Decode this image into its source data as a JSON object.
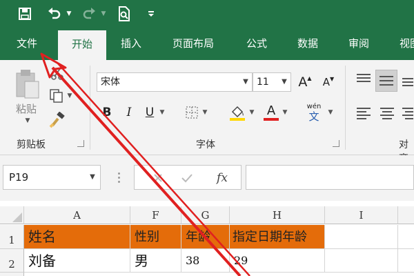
{
  "colors": {
    "brand": "#217346",
    "ribbon_bg": "#f3f3f3",
    "header_fill": "#e46c0a",
    "annotation": "#e02020"
  },
  "quick_access": {
    "icons": [
      "save-icon",
      "undo-icon",
      "redo-icon",
      "print-preview-icon",
      "customize-icon"
    ]
  },
  "tabs": [
    "文件",
    "开始",
    "插入",
    "页面布局",
    "公式",
    "数据",
    "审阅",
    "视图"
  ],
  "active_tab": "开始",
  "clipboard": {
    "paste_label": "粘贴",
    "group_label": "剪贴板"
  },
  "font": {
    "name": "宋体",
    "size": "11",
    "grow_label": "A",
    "shrink_label": "A",
    "bold_label": "B",
    "italic_label": "I",
    "underline_label": "U",
    "fontcolor_label": "A",
    "phonetic_top": "wén",
    "phonetic_bottom": "文",
    "group_label": "字体"
  },
  "alignment": {
    "group_label": "对齐"
  },
  "formula_bar": {
    "name_box": "P19",
    "fx_label": "fx",
    "content": ""
  },
  "grid": {
    "columns": [
      "A",
      "F",
      "G",
      "H",
      "I"
    ],
    "rows": [
      {
        "num": "1",
        "cells": [
          "姓名",
          "性别",
          "年龄",
          "指定日期年龄",
          ""
        ]
      },
      {
        "num": "2",
        "cells": [
          "刘备",
          "男",
          "38",
          "29",
          ""
        ]
      }
    ]
  }
}
